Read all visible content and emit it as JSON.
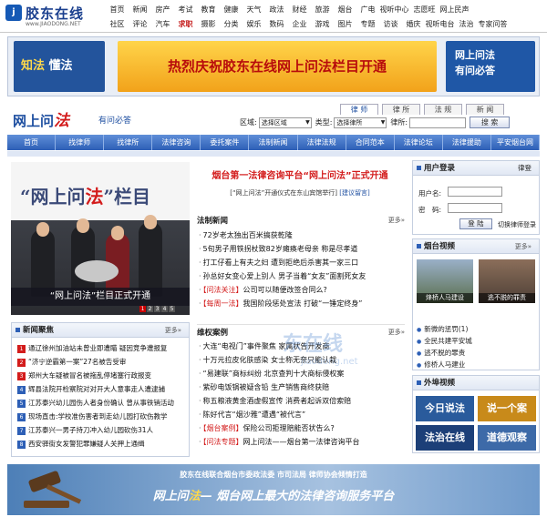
{
  "logo": {
    "name": "胶东在线",
    "url": "www.JIAODONG.NET",
    "mark": "j"
  },
  "topnav": {
    "row1": [
      "首页",
      "新闻",
      "房产",
      "考试",
      "教育",
      "健康",
      "天气",
      "政法",
      "财经",
      "旅游",
      "烟台",
      "广电",
      "视听中心",
      "志愿旺",
      "网上民声"
    ],
    "row2": [
      "社区",
      "评论",
      "汽车",
      "求职",
      "摄影",
      "分类",
      "娱乐",
      "数码",
      "企业",
      "游戏",
      "图片",
      "专题",
      "访谈",
      "婚庆",
      "视听电台",
      "法治",
      "专家问答"
    ],
    "highlight": "求职"
  },
  "banner": {
    "left_a": "知法",
    "left_b": "懂法",
    "main": "热烈庆祝胶东在线网上问法栏目开通",
    "right_line1": "网上问法",
    "right_line2": "有问必答"
  },
  "site": {
    "title_a": "网上问",
    "title_b": "法",
    "subtitle": "有问必答"
  },
  "tabs": [
    "律 师",
    "律 所",
    "法 规",
    "新 闻"
  ],
  "search": {
    "region_label": "区域:",
    "region_value": "选择区域",
    "type_label": "类型:",
    "type_value": "选择律所",
    "keyword_label": "律所:",
    "button": "搜 索"
  },
  "mainnav": [
    "首页",
    "找律师",
    "找律所",
    "法律咨询",
    "委托案件",
    "法制新闻",
    "法律法规",
    "合同范本",
    "法律论坛",
    "法律援助",
    "平安烟台网"
  ],
  "hero": {
    "big_a": "“网上问",
    "big_b": "法",
    "big_c": "”栏目",
    "caption": "“网上问法”栏目正式开通",
    "dots": [
      "1",
      "2",
      "3",
      "4",
      "5"
    ]
  },
  "headline": {
    "title": "烟台第一法律咨询平台“网上问法”正式开通",
    "sub_text": "[“网上问法”开通仪式在东山宾馆举行]",
    "sub_link": "[建议留言]"
  },
  "law_news": {
    "title": "法制新闻",
    "more": "更多»",
    "items": [
      {
        "tag": "",
        "text": "72岁老太独出百米搞获乾隆"
      },
      {
        "tag": "",
        "text": "5旬男子用铁拐杖致82岁瘫痪老母亲 称是尽孝道"
      },
      {
        "tag": "",
        "text": "打工仔看上有夫之妇 遭到拒绝后杀害其一家三口"
      },
      {
        "tag": "",
        "text": "孙总好女变心爱上别人 男子当着“女友”面割死女友"
      },
      {
        "tag": "【问法关注】",
        "text": "公司可以随便改签合同么?"
      },
      {
        "tag": "【每周一法】",
        "text": "我国阶段惩处宣法 打破“一锤定终身”"
      }
    ]
  },
  "cases": {
    "title": "维权案例",
    "more": "更多»",
    "items": [
      {
        "tag": "",
        "text": "大连“电视门”事件聚焦 家属状告开发商"
      },
      {
        "tag": "",
        "text": "十万元拉皮化肤感染 女士称无奈只能认栽"
      },
      {
        "tag": "",
        "text": "“易建联”商标纠纷 北京查判十大商标侵权案"
      },
      {
        "tag": "",
        "text": "紫砂电饭锅被疑含铅 生产销售商终获赔"
      },
      {
        "tag": "",
        "text": "称五粮液黄金酒虚假宣传 消费者起诉双倍索赔"
      },
      {
        "tag": "",
        "text": "陈好代言“烟沙雅”遭遇“被代言”"
      },
      {
        "tag": "【烟台案例】",
        "text": "保险公司拒理赔能否状告么?"
      },
      {
        "tag": "【问法专题】",
        "text": "网上问法——烟台第一法律咨询平台"
      }
    ]
  },
  "focus": {
    "title": "新闻聚焦",
    "more": "更多»",
    "items": [
      "通辽徐州加油站未曾业即遭瞄 疑因竞争遭报复",
      "“济宁逆霸第一案”27名被告受审",
      "郑州大车疑被冒名被拖乱停堵塞行政报变",
      "辉县法院开检察院对对开大人意事走人遭逮捕",
      "江苏泰兴幼儿园伤人者身份确认 曾从事铁销活动",
      "现场直击:学校准伤害者到走幼儿园打砍伤教学",
      "江苏泰兴一男子持刀冲入幼儿园砍伤31人",
      "西安驿街女发警犯罪嫌疑人关押上通缉"
    ]
  },
  "login": {
    "title": "用户登录",
    "lawyer_link": "律登",
    "user_label": "用户名:",
    "pass_label": "密　码:",
    "button": "登 陆",
    "switch": "切换律师登录"
  },
  "video": {
    "title": "烟台视频",
    "more": "更多»",
    "thumb1": "烽桥人马建设",
    "thumb2": "逃不脱的罪责",
    "items": [
      "新微的惩罚(1)",
      "全民共建平安城",
      "逃不脱的罪责",
      "修桥人马建业"
    ]
  },
  "ext_video": {
    "title": "外埠视频",
    "ads": [
      "今日说法",
      "说一个案",
      "法治在线",
      "道德观察"
    ]
  },
  "footer": {
    "top": "胶东在线联合烟台市委政法委 市司法局 律师协会倾情打造",
    "main_a": "网上问",
    "main_b": "法",
    "main_c": "— 烟台网上最大的法律咨询服务平台"
  },
  "watermark": {
    "text": "东在线",
    "url": "jiaodong.net"
  },
  "colors": {
    "brand_blue": "#2d5fb6",
    "accent_red": "#d31c1c",
    "banner_gold": "#f2a21a"
  }
}
